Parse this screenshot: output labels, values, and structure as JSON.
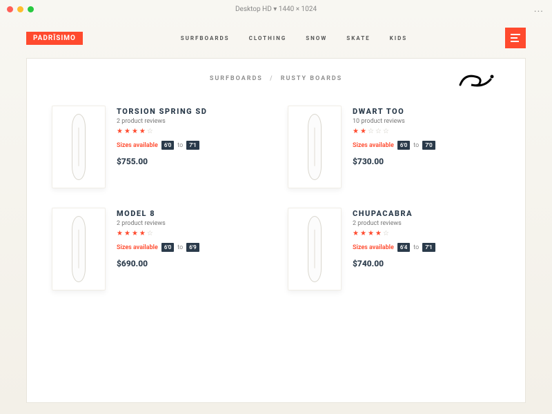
{
  "titlebar": {
    "device": "Desktop HD",
    "dims": "1440 × 1024",
    "dots": "..."
  },
  "header": {
    "logo": "PADRĪSIMO",
    "nav": [
      "SURFBOARDS",
      "CLOTHING",
      "SNOW",
      "SKATE",
      "KIDS"
    ]
  },
  "breadcrumb": {
    "cat": "SURFBOARDS",
    "sub": "RUSTY BOARDS"
  },
  "sizes_label": "Sizes available",
  "to_label": "to",
  "products": [
    {
      "name": "TORSION SPRING SD",
      "reviews": "2 product reviews",
      "stars": 4,
      "size_min": "6'0",
      "size_max": "7'1",
      "price": "$755.00"
    },
    {
      "name": "DWART TOO",
      "reviews": "10 product reviews",
      "stars": 2,
      "size_min": "6'0",
      "size_max": "7'0",
      "price": "$730.00"
    },
    {
      "name": "MODEL 8",
      "reviews": "2 product reviews",
      "stars": 4,
      "size_min": "6'0",
      "size_max": "6'9",
      "price": "$690.00"
    },
    {
      "name": "CHUPACABRA",
      "reviews": "2 product reviews",
      "stars": 4,
      "size_min": "6'4",
      "size_max": "7'1",
      "price": "$740.00"
    }
  ]
}
